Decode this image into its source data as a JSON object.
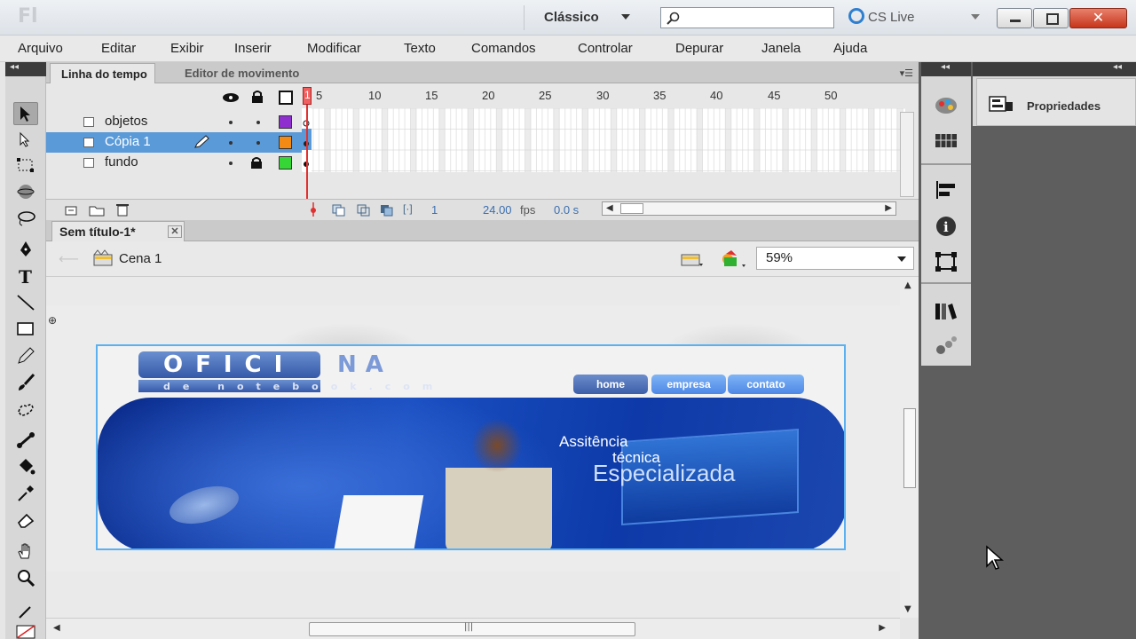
{
  "app": {
    "logo": "Fl",
    "workspace": "Clássico",
    "cs_live": "CS Live",
    "search_placeholder": ""
  },
  "window_buttons": {
    "close": "✕"
  },
  "menu": [
    "Arquivo",
    "Editar",
    "Exibir",
    "Inserir",
    "Modificar",
    "Texto",
    "Comandos",
    "Controlar",
    "Depurar",
    "Janela",
    "Ajuda"
  ],
  "timeline": {
    "tabs": [
      "Linha do tempo",
      "Editor de movimento"
    ],
    "ruler": [
      "1",
      "5",
      "10",
      "15",
      "20",
      "25",
      "30",
      "35",
      "40",
      "45",
      "50"
    ],
    "layers": [
      {
        "name": "objetos",
        "color": "#8f2fd0",
        "selected": false
      },
      {
        "name": "Cópia 1",
        "color": "#f28a14",
        "selected": true
      },
      {
        "name": "fundo",
        "color": "#36d636",
        "selected": false
      }
    ],
    "current_frame": "1",
    "fps": "24.00",
    "fps_unit": "fps",
    "time": "0.0 s"
  },
  "document": {
    "tab": "Sem título-1*",
    "scene": "Cena 1",
    "zoom": "59%"
  },
  "banner": {
    "logo": "OFICI",
    "logo_tail": "NA",
    "logo_sub": "de notebook.com",
    "nav": [
      "home",
      "empresa",
      "contato"
    ],
    "headline1": "Assitência",
    "headline2": "técnica",
    "headline3": "Especializada"
  },
  "properties": {
    "title": "Propriedades"
  }
}
